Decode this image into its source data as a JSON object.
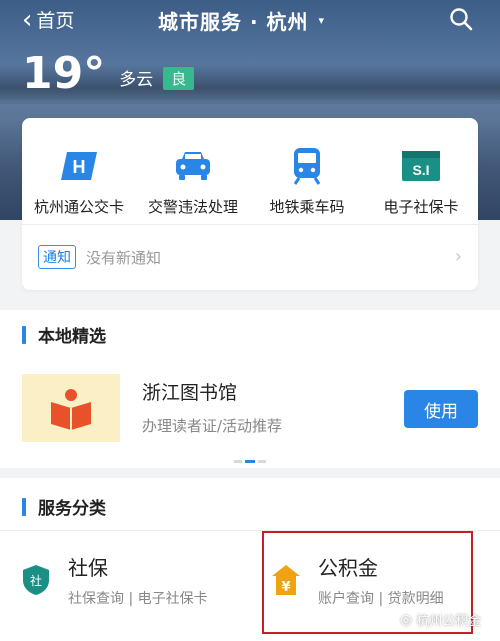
{
  "header": {
    "back_label": "首页",
    "title": "城市服务 · 杭州",
    "title_caret": "▾"
  },
  "weather": {
    "temperature": "19°",
    "condition": "多云",
    "air_quality": "良"
  },
  "quick_services": [
    {
      "label": "杭州通公交卡",
      "icon": "bus-card-icon"
    },
    {
      "label": "交警违法处理",
      "icon": "traffic-police-car-icon"
    },
    {
      "label": "地铁乘车码",
      "icon": "metro-train-icon"
    },
    {
      "label": "电子社保卡",
      "icon": "social-security-card-icon"
    }
  ],
  "notice": {
    "tag": "通知",
    "text": "没有新通知",
    "arrow": "›"
  },
  "local_picks": {
    "heading": "本地精选",
    "item": {
      "name": "浙江图书馆",
      "subtitle": "办理读者证/活动推荐",
      "button": "使用"
    }
  },
  "categories": {
    "heading": "服务分类",
    "items": [
      {
        "name": "社保",
        "subtitle": "社保查询 | 电子社保卡",
        "icon": "social-security-shield-icon"
      },
      {
        "name": "公积金",
        "subtitle": "账户查询 | 贷款明细",
        "icon": "housing-fund-icon"
      }
    ]
  },
  "watermark": "杭州公积金",
  "colors": {
    "accent": "#2a86e6",
    "aqi_green": "#36b98c",
    "highlight_red": "#c21f28",
    "social_security_teal": "#1a8f86",
    "housing_fund_orange": "#f0a215"
  }
}
